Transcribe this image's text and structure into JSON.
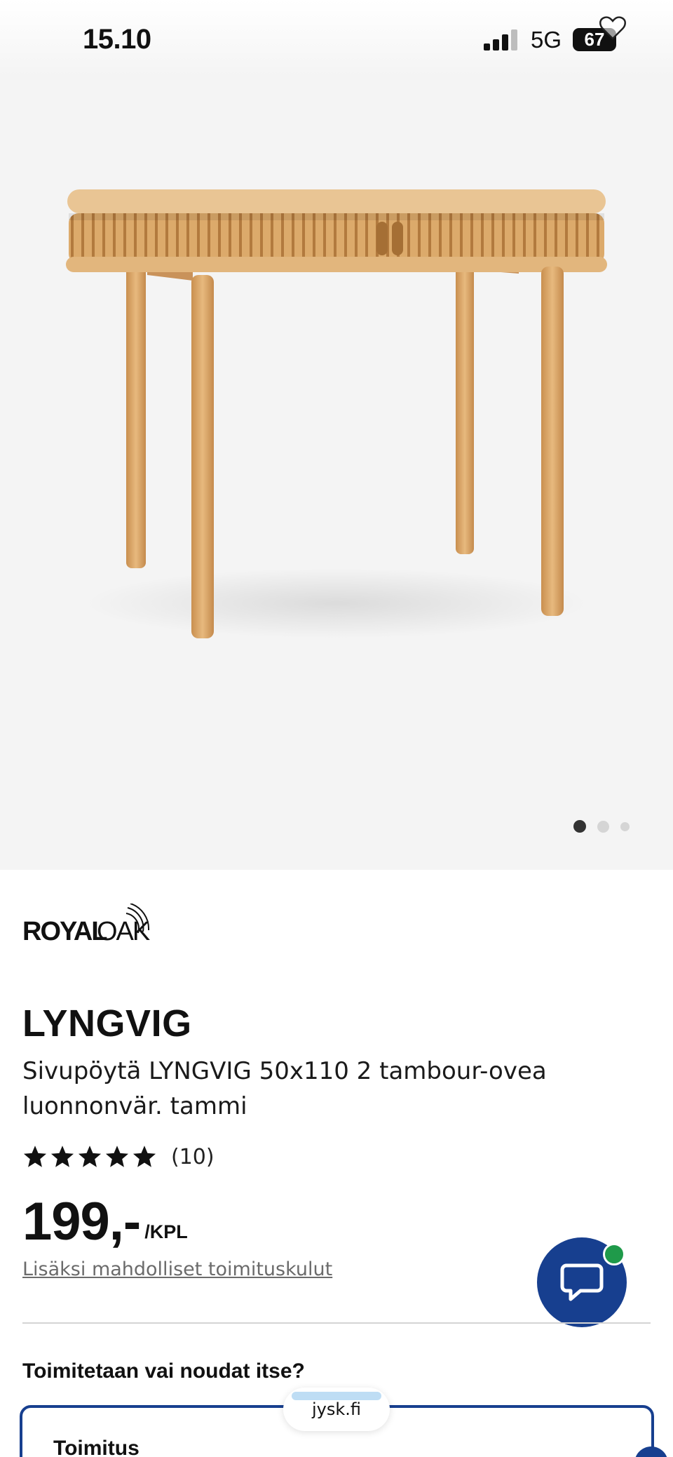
{
  "status_bar": {
    "time": "15.10",
    "network": "5G",
    "battery": "67"
  },
  "gallery": {
    "active_image": 1,
    "image_count": 3
  },
  "brand": {
    "name": "ROYAL OAK"
  },
  "product": {
    "name": "LYNGVIG",
    "description": "Sivupöytä LYNGVIG 50x110 2 tambour-ovea luonnonvär. tammi",
    "rating": {
      "stars": 5,
      "review_count": "(10)"
    },
    "price": "199,-",
    "price_unit": "/KPL",
    "shipping_note": "Lisäksi mahdolliset toimituskulut"
  },
  "delivery": {
    "heading": "Toimitetaan vai noudat itse?",
    "option_title": "Toimitus"
  },
  "browser": {
    "url": "jysk.fi"
  },
  "colors": {
    "brand_blue": "#173f8f",
    "online_green": "#1f9a4a",
    "wood": "#deae6e"
  }
}
